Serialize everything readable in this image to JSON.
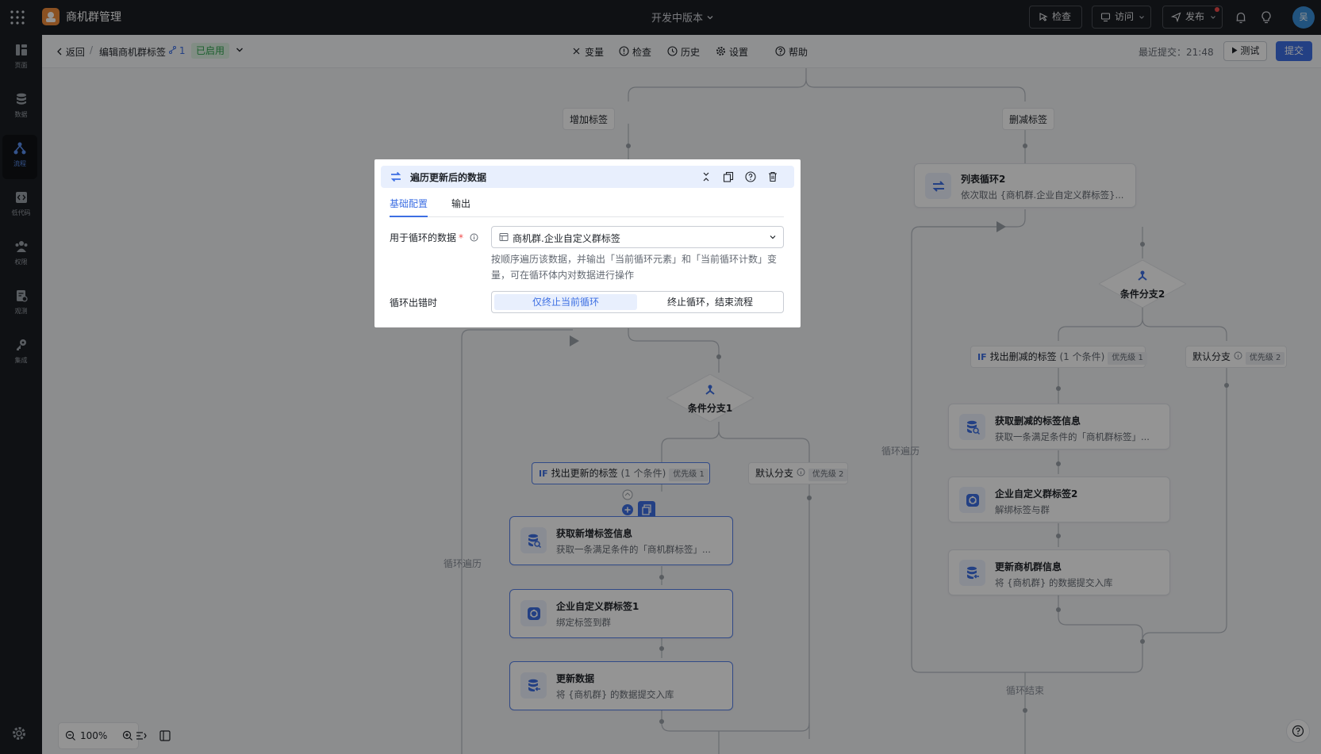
{
  "app": {
    "name": "商机群管理",
    "version_label": "开发中版本"
  },
  "topbar": {
    "inspect": "检查",
    "visit": "访问",
    "publish": "发布",
    "avatar_text": "吴"
  },
  "sidebar": {
    "items": [
      {
        "label": "页面",
        "icon": "pages-icon"
      },
      {
        "label": "数据",
        "icon": "database-icon"
      },
      {
        "label": "流程",
        "icon": "flow-icon"
      },
      {
        "label": "低代码",
        "icon": "code-icon"
      },
      {
        "label": "权限",
        "icon": "users-icon"
      },
      {
        "label": "观测",
        "icon": "monitor-icon"
      },
      {
        "label": "集成",
        "icon": "key-icon"
      }
    ]
  },
  "subbar": {
    "back": "返回",
    "separator": "/",
    "title": "编辑商机群标签",
    "version_num": "1",
    "status": "已启用",
    "tools": [
      "变量",
      "检查",
      "历史",
      "设置",
      "帮助"
    ],
    "last_submit": "最近提交：21:48",
    "test": "测试",
    "submit": "提交"
  },
  "canvas": {
    "labels": {
      "add_tag": "增加标签",
      "remove_tag": "删减标签"
    },
    "list_loop2": {
      "title": "列表循环2",
      "desc": "依次取出 {商机群.企业自定义群标签}..."
    },
    "cond1": {
      "title": "条件分支1"
    },
    "cond2": {
      "title": "条件分支2"
    },
    "branch_left_if": {
      "if": "IF",
      "name": "找出更新的标签",
      "cond": "(1 个条件)",
      "priority": "优先级 1"
    },
    "branch_left_default": {
      "name": "默认分支",
      "priority": "优先级 2"
    },
    "branch_right_if": {
      "if": "IF",
      "name": "找出删减的标签",
      "cond": "(1 个条件)",
      "priority": "优先级 1"
    },
    "branch_right_default": {
      "name": "默认分支",
      "priority": "优先级 2"
    },
    "nodes_left": [
      {
        "title": "获取新增标签信息",
        "desc": "获取一条满足条件的「商机群标签」..."
      },
      {
        "title": "企业自定义群标签1",
        "desc": "绑定标签到群"
      },
      {
        "title": "更新数据",
        "desc": "将 {商机群} 的数据提交入库"
      }
    ],
    "nodes_right": [
      {
        "title": "获取删减的标签信息",
        "desc": "获取一条满足条件的「商机群标签」..."
      },
      {
        "title": "企业自定义群标签2",
        "desc": "解绑标签与群"
      },
      {
        "title": "更新商机群信息",
        "desc": "将 {商机群} 的数据提交入库"
      }
    ],
    "loop_left": "循环遍历",
    "loop_right": "循环遍历",
    "loop_end": "循环结束",
    "zoom": "100%"
  },
  "panel": {
    "title": "遍历更新后的数据",
    "tabs": [
      "基础配置",
      "输出"
    ],
    "field_data_label": "用于循环的数据",
    "field_data_required": "*",
    "field_data_value": "商机群.企业自定义群标签",
    "hint": "按顺序遍历该数据，并输出「当前循环元素」和「当前循环计数」变量，可在循环体内对数据进行操作",
    "field_error_label": "循环出错时",
    "error_options": [
      "仅终止当前循环",
      "终止循环，结束流程"
    ],
    "error_selected": "仅终止当前循环"
  },
  "colors": {
    "accent": "#3d6fe3",
    "dark": "#1b1e23",
    "enabled_green": "#2ea44f"
  }
}
